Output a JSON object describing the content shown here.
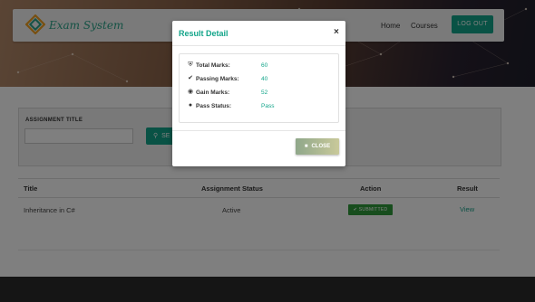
{
  "header": {
    "logo_text": "Exam System",
    "nav": {
      "home": "Home",
      "courses": "Courses"
    },
    "logout_label": "LOG OUT"
  },
  "filter": {
    "label": "ASSIGNMENT TITLE",
    "input_value": "",
    "search_label": "SE"
  },
  "table": {
    "headers": [
      "Title",
      "Assignment Status",
      "Action",
      "Result"
    ],
    "rows": [
      {
        "title": "Inheritance in C#",
        "status": "Active",
        "action": "✔ SUBMITTED",
        "result": "View"
      }
    ]
  },
  "modal": {
    "title": "Result Detail",
    "close_x": "×",
    "details": [
      {
        "icon": "shield-icon",
        "label": "Total Marks:",
        "value": "60"
      },
      {
        "icon": "check-icon",
        "label": "Passing Marks:",
        "value": "40"
      },
      {
        "icon": "pin-icon",
        "label": "Gain Marks:",
        "value": "52"
      },
      {
        "icon": "user-icon",
        "label": "Pass Status:",
        "value": "Pass"
      }
    ],
    "close_label": "CLOSE"
  },
  "colors": {
    "accent": "#13a58a",
    "badge": "#2f9a3a",
    "footer": "#2b2b2b"
  }
}
